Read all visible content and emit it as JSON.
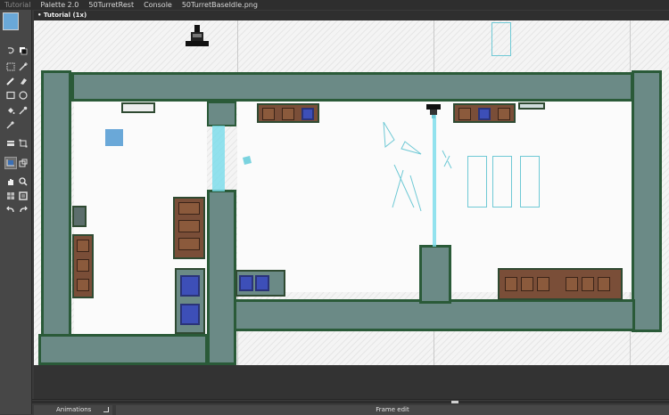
{
  "tabs": [
    {
      "label": "Tutorial",
      "active": false
    },
    {
      "label": "Palette 2.0",
      "active": true
    },
    {
      "label": "50TurretRest",
      "active": true
    },
    {
      "label": "Console",
      "active": true
    },
    {
      "label": "50TurretBaseIdle.png",
      "active": true
    }
  ],
  "document": {
    "title": "• Tutorial   (1x)"
  },
  "tools": {
    "primary_color": "#6aa8d8",
    "items": [
      "lasso-icon",
      "color-swap-icon",
      "select-rect-icon",
      "magic-wand-icon",
      "pencil-icon",
      "eraser-icon",
      "rectangle-icon",
      "ellipse-icon",
      "fill-bucket-icon",
      "eyedropper-icon",
      "color-picker-icon",
      "layer-icon",
      "transform-icon",
      "crop-icon",
      "paste-icon",
      "hand-icon",
      "zoom-icon",
      "grid-icon",
      "frame-icon",
      "undo-icon",
      "redo-icon"
    ]
  },
  "bottom": {
    "animations_label": "Animations",
    "frame_edit_label": "Frame edit"
  },
  "colors": {
    "wall_fill": "#6b8a86",
    "wall_border": "#2a5a38",
    "beam": "#78dceb",
    "cabinet": "#7a4e38",
    "blue_tile": "#3d4fb8"
  }
}
